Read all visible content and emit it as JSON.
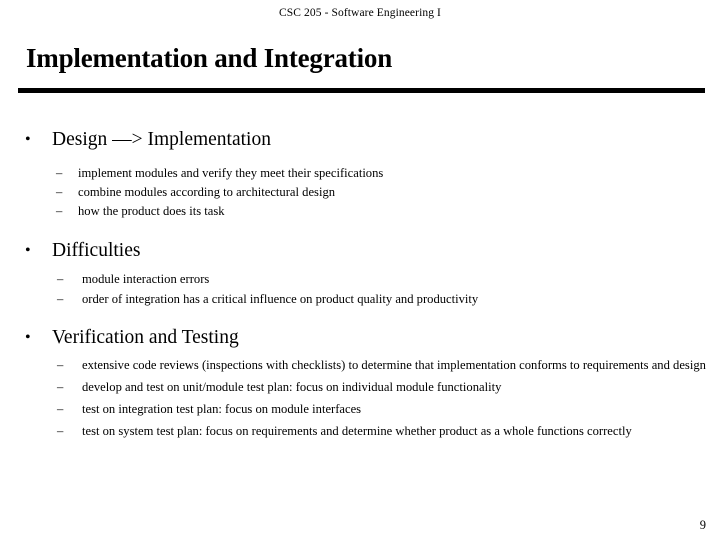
{
  "header": {
    "course": "CSC 205 - Software Engineering I"
  },
  "title": "Implementation and Integration",
  "bullets": {
    "marker_dot": "•",
    "marker_dash": "–"
  },
  "sections": [
    {
      "heading": "Design —> Implementation",
      "items": [
        "implement modules and verify they meet their specifications",
        "combine modules according to architectural design",
        "how  the product does its task"
      ]
    },
    {
      "heading": "Difficulties",
      "items": [
        "module interaction errors",
        "order of integration has a critical influence on product quality and productivity"
      ]
    },
    {
      "heading": "Verification and Testing",
      "items": [
        "extensive code reviews (inspections with checklists) to determine that implementation conforms to requirements and design",
        "develop and test on unit/module test plan: focus on individual module functionality",
        "test on integration test plan: focus on module interfaces",
        "test on system test plan: focus on requirements and determine whether product as a whole functions correctly"
      ]
    }
  ],
  "footer": {
    "page_number": "9"
  }
}
